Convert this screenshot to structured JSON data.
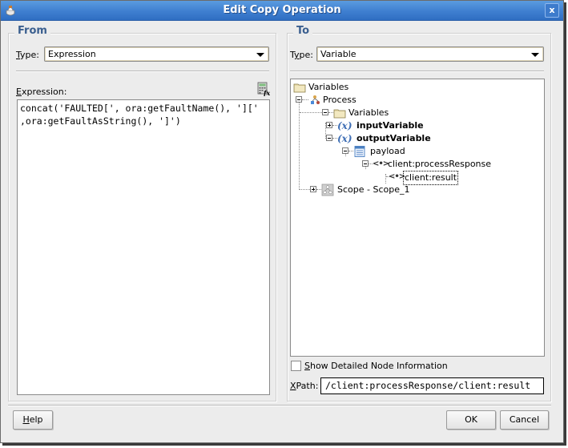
{
  "window": {
    "title": "Edit Copy Operation",
    "close_label": "x"
  },
  "from": {
    "group_title": "From",
    "type_label_mnemonic": "T",
    "type_label_rest": "ype:",
    "type_value": "Expression",
    "expression_label_mnemonic": "E",
    "expression_label_rest": "xpression:",
    "expression_value": "concat('FAULTED[', ora:getFaultName(), '][' \n,ora:getFaultAsString(), ']')",
    "expression_builder_icon": "expression-builder-icon"
  },
  "to": {
    "group_title": "To",
    "type_label_pre": "T",
    "type_label_mnemonic": "y",
    "type_label_rest": "pe:",
    "type_value": "Variable",
    "tree": [
      {
        "label": "Variables",
        "icon": "folder-icon",
        "bold": false,
        "expander": "none"
      },
      {
        "label": "Process",
        "icon": "process-icon",
        "bold": false,
        "expander": "minus"
      },
      {
        "label": "Variables",
        "icon": "folder-icon",
        "bold": false,
        "expander": "minus"
      },
      {
        "label": "inputVariable",
        "icon": "variable-icon",
        "bold": true,
        "expander": "plus"
      },
      {
        "label": "outputVariable",
        "icon": "variable-icon",
        "bold": true,
        "expander": "minus"
      },
      {
        "label": "payload",
        "icon": "message-part-icon",
        "bold": false,
        "expander": "minus"
      },
      {
        "label": "client:processResponse",
        "icon": "element-icon",
        "bold": false,
        "expander": "minus"
      },
      {
        "label": "client:result",
        "icon": "element-icon",
        "bold": false,
        "expander": "none",
        "selected": true
      },
      {
        "label": "Scope - Scope_1",
        "icon": "scope-icon",
        "bold": false,
        "expander": "plus"
      }
    ],
    "show_detailed_mnemonic": "S",
    "show_detailed_rest": "how Detailed Node Information",
    "show_detailed_checked": false,
    "xpath_label_mnemonic": "X",
    "xpath_label_rest": "Path:",
    "xpath_value": "/client:processResponse/client:result"
  },
  "buttons": {
    "help_mnemonic": "H",
    "help_rest": "elp",
    "ok": "OK",
    "cancel": "Cancel"
  },
  "colors": {
    "titlebar": "#3f7fd0",
    "group_title": "#3b5f8f",
    "background": "#ececec"
  }
}
